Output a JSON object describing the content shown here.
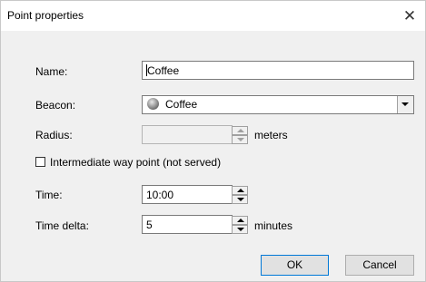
{
  "window": {
    "title": "Point properties",
    "close_label": "✕"
  },
  "form": {
    "name_label": "Name:",
    "name_value": "Coffee",
    "beacon_label": "Beacon:",
    "beacon_value": "Coffee",
    "radius_label": "Radius:",
    "radius_value": "",
    "radius_unit": "meters",
    "intermediate_label": "Intermediate way point (not served)",
    "intermediate_checked": false,
    "time_label": "Time:",
    "time_value": "10:00",
    "time_delta_label": "Time delta:",
    "time_delta_value": "5",
    "time_delta_unit": "minutes"
  },
  "buttons": {
    "ok": "OK",
    "cancel": "Cancel"
  },
  "icons": {
    "beacon": "coffee-beacon-icon",
    "close": "close-icon"
  }
}
